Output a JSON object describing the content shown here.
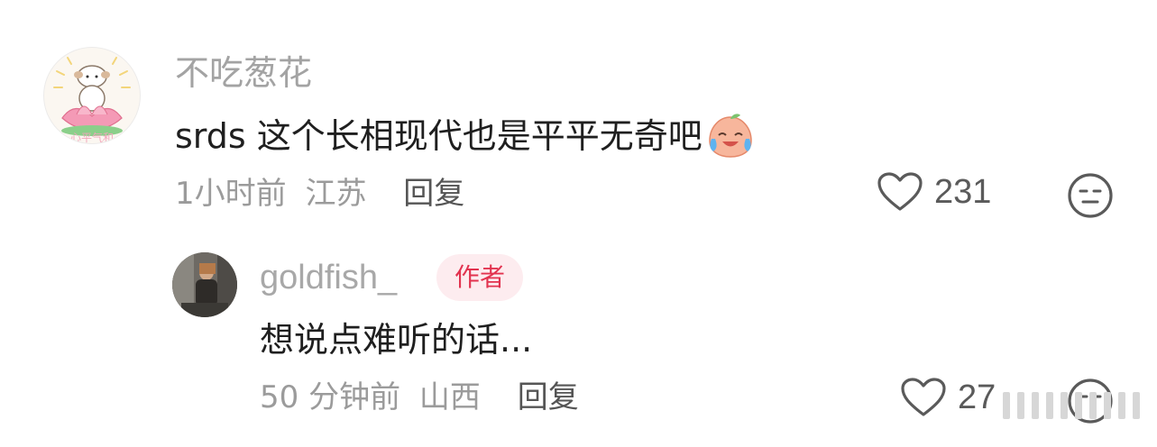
{
  "comment": {
    "username": "不吃葱花",
    "text": "srds 这个长相现代也是平平无奇吧",
    "time": "1小时前",
    "location": "江苏",
    "reply_label": "回复",
    "like_count": "231",
    "avatar_text": "不吃葱花"
  },
  "reply": {
    "username": "goldfish_",
    "badge": "作者",
    "text": "想说点难听的话...",
    "time": "50 分钟前",
    "location": "山西",
    "reply_label": "回复",
    "like_count": "27"
  },
  "colors": {
    "accent": "#e2334f",
    "badge_bg": "#fdecef",
    "meta": "#9b9b9b",
    "body_text": "#1f1f1f"
  },
  "icons": {
    "like": "heart-outline-icon",
    "dislike": "neutral-face-icon",
    "emoji": "crying-laughing-peach-emoji"
  }
}
